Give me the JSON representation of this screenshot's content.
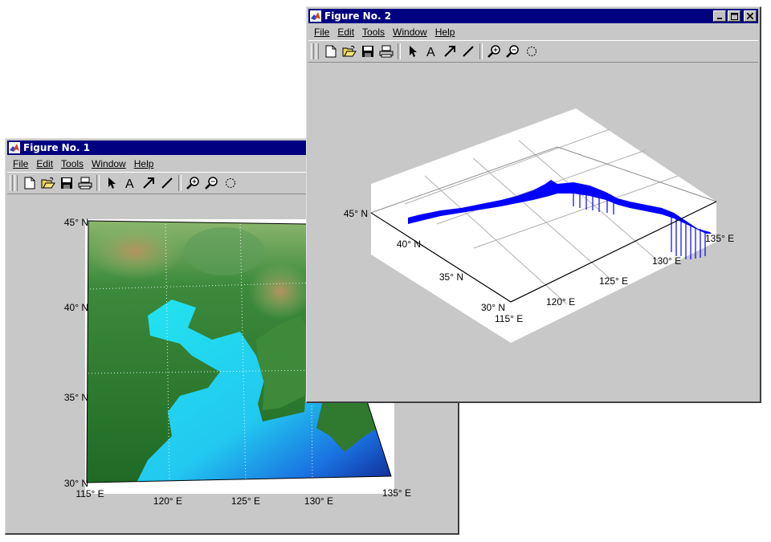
{
  "windows": [
    {
      "title": "Figure No. 1",
      "menus": [
        "File",
        "Edit",
        "Tools",
        "Window",
        "Help"
      ],
      "map": {
        "lat_labels": [
          "45° N",
          "40° N",
          "35° N",
          "30° N"
        ],
        "lon_labels": [
          "115° E",
          "120° E",
          "125° E",
          "130° E",
          "135° E"
        ]
      }
    },
    {
      "title": "Figure No. 2",
      "menus": [
        "File",
        "Edit",
        "Tools",
        "Window",
        "Help"
      ],
      "plot3d": {
        "lat_labels": [
          "45° N",
          "40° N",
          "35° N",
          "30° N"
        ],
        "lon_labels": [
          "115° E",
          "120° E",
          "125° E",
          "130° E",
          "135° E"
        ]
      }
    }
  ],
  "toolbar_tools": [
    "new-file",
    "open-file",
    "save",
    "print",
    "select-arrow",
    "insert-text",
    "insert-arrow",
    "insert-line",
    "zoom-in",
    "zoom-out",
    "rotate"
  ],
  "colors": {
    "title_bar": "#000080",
    "window_face": "#c8c8c8",
    "land_low": "#2f7a2f",
    "land_high": "#b08a5a",
    "sea_shallow": "#22e5ef",
    "sea_deep": "#1c2fb0",
    "profile": "#0000ff"
  }
}
